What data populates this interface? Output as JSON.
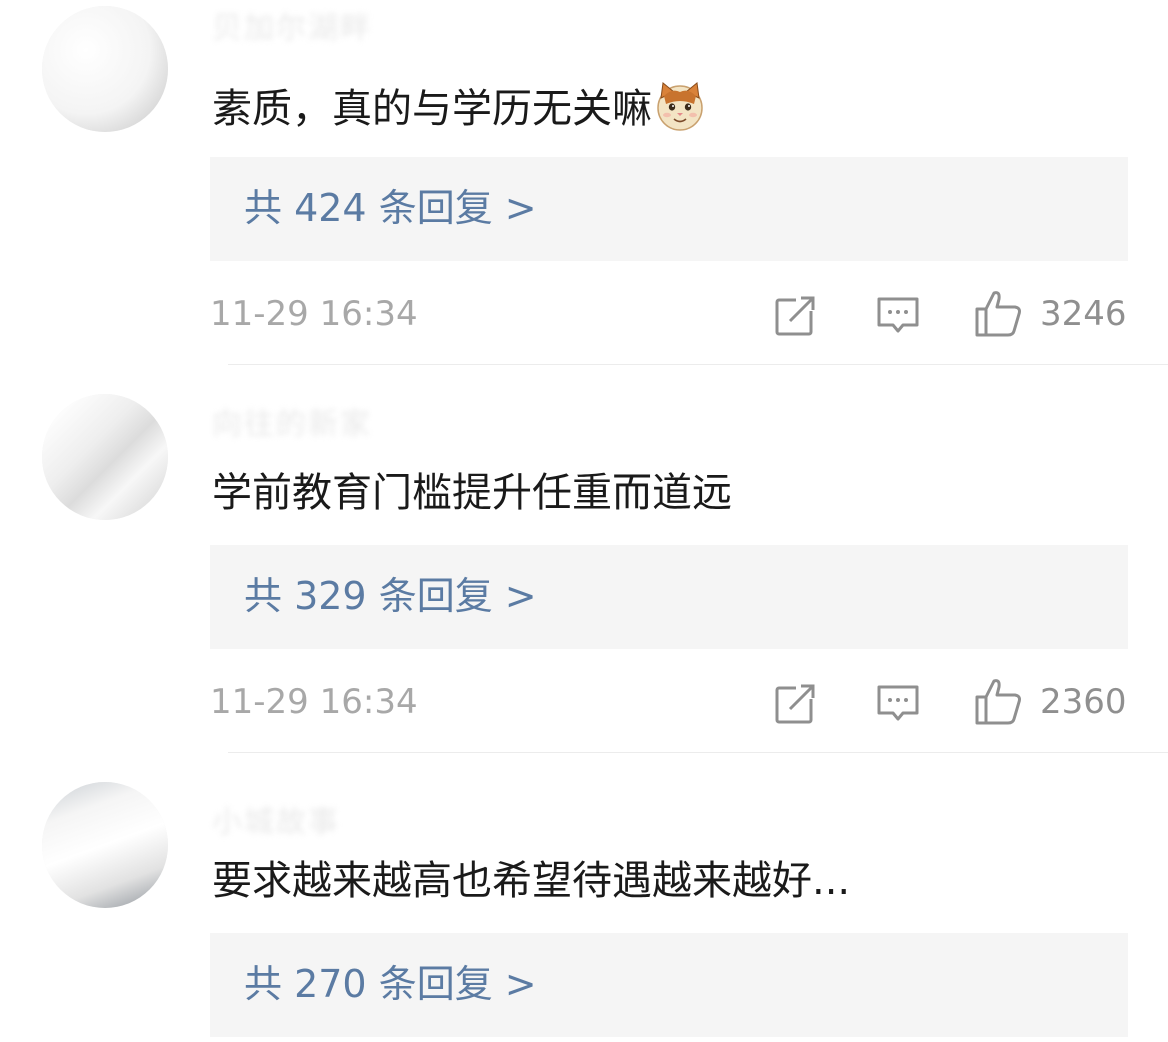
{
  "comments": [
    {
      "username": "贝加尔湖畔",
      "text": "素质，真的与学历无关嘛",
      "emoji": "cat-emoji",
      "replies_label": "共 424 条回复 >",
      "time": "11-29 16:34",
      "likes": "3246"
    },
    {
      "username": "向往的新家",
      "text": "学前教育门槛提升任重而道远",
      "replies_label": "共 329 条回复 >",
      "time": "11-29 16:34",
      "likes": "2360"
    },
    {
      "username": "小城故事",
      "text": "要求越来越高也希望待遇越来越好...",
      "replies_label": "共 270 条回复 >"
    }
  ],
  "colors": {
    "link_blue": "#5b7ba3",
    "reply_box_bg": "#f5f5f5",
    "meta_gray": "#a8a8a8",
    "text_dark": "#1a1a1a"
  },
  "icons": {
    "share": "share-icon",
    "reply": "comment-icon",
    "like": "thumbs-up-icon"
  }
}
